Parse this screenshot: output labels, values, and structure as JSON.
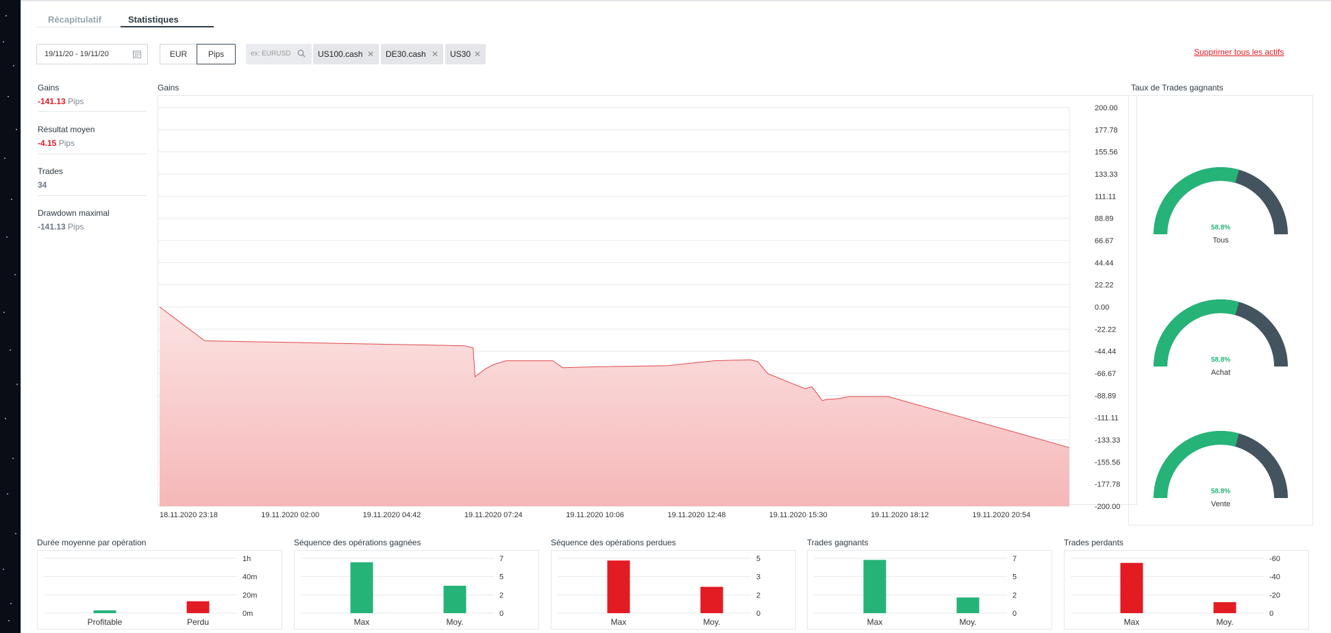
{
  "tabs": [
    {
      "label": "Récapitulatif",
      "active": false
    },
    {
      "label": "Statistiques",
      "active": true
    }
  ],
  "filters": {
    "date_range": "19/11/20 - 19/11/20",
    "units": [
      {
        "label": "EUR",
        "active": false
      },
      {
        "label": "Pips",
        "active": true
      }
    ],
    "search_placeholder": "ex: EURUSD",
    "assets": [
      "US100.cash",
      "DE30.cash",
      "US30"
    ],
    "remove_all": "Supprimer tous les actifs"
  },
  "stats": [
    {
      "label": "Gains",
      "value": "-141.13",
      "unit": "Pips",
      "tone": "red"
    },
    {
      "label": "Résultat moyen",
      "value": "-4.15",
      "unit": "Pips",
      "tone": "red"
    },
    {
      "label": "Trades",
      "value": "34",
      "unit": "",
      "tone": "grey"
    },
    {
      "label": "Drawdown maximal",
      "value": "-141.13",
      "unit": "Pips",
      "tone": "grey"
    }
  ],
  "main_chart_title": "Gains",
  "winrate_title": "Taux de Trades gagnants",
  "chart_data": [
    {
      "type": "area",
      "title": "Gains",
      "ylim": [
        -200,
        200
      ],
      "y_ticks": [
        "200.00",
        "177.78",
        "155.56",
        "133.33",
        "111.11",
        "88.89",
        "66.67",
        "44.44",
        "22.22",
        "0.00",
        "-22.22",
        "-44.44",
        "-66.67",
        "-88.89",
        "-111.11",
        "-133.33",
        "-155.56",
        "-177.78",
        "-200.00"
      ],
      "x_ticks": [
        "18.11.2020 23:18",
        "19.11.2020 02:00",
        "19.11.2020 04:42",
        "19.11.2020 07:24",
        "19.11.2020 10:06",
        "19.11.2020 12:48",
        "19.11.2020 15:30",
        "19.11.2020 18:12",
        "19.11.2020 20:54"
      ],
      "series": [
        {
          "x": [
            "18.11.2020 23:18",
            "19.11.2020 00:30",
            "19.11.2020 07:24",
            "19.11.2020 07:38",
            "19.11.2020 07:41",
            "19.11.2020 07:58",
            "19.11.2020 08:10",
            "19.11.2020 08:30",
            "19.11.2020 09:45",
            "19.11.2020 10:01",
            "19.11.2020 11:00",
            "19.11.2020 12:48",
            "19.11.2020 14:02",
            "19.11.2020 15:00",
            "19.11.2020 15:12",
            "19.11.2020 15:28",
            "19.11.2020 16:27",
            "19.11.2020 16:38",
            "19.11.2020 16:55",
            "19.11.2020 17:00",
            "19.11.2020 17:20",
            "19.11.2020 17:37",
            "19.11.2020 18:40",
            "19.11.2020 23:45"
          ],
          "y": [
            0,
            -34,
            -39,
            -41,
            -70,
            -62,
            -58,
            -54,
            -54,
            -61,
            -60,
            -59,
            -54,
            -53,
            -55,
            -67,
            -82,
            -80,
            -94,
            -93,
            -92,
            -90,
            -90,
            -141.13
          ]
        }
      ]
    },
    {
      "type": "gauge",
      "title": "Taux de Trades gagnants",
      "items": [
        {
          "label": "Tous",
          "value": 58.8,
          "display": "58.8%"
        },
        {
          "label": "Achat",
          "value": 58.8,
          "display": "58.8%"
        },
        {
          "label": "Vente",
          "value": 58.8,
          "display": "58.8%"
        }
      ]
    },
    {
      "type": "bar",
      "title": "Durée moyenne par opération",
      "categories": [
        "Profitable",
        "Perdu"
      ],
      "values_min": [
        3,
        13
      ],
      "ylim_min": [
        0,
        60
      ],
      "y_ticks": [
        "1h",
        "40m",
        "20m",
        "0m"
      ]
    },
    {
      "type": "bar",
      "title": "Séquence des opérations gagnées",
      "categories": [
        "Max",
        "Moy."
      ],
      "values": [
        6.5,
        3.5
      ],
      "ylim": [
        0,
        7
      ],
      "y_ticks": [
        "7",
        "5",
        "2",
        "0"
      ]
    },
    {
      "type": "bar",
      "title": "Séquence des opérations perdues",
      "categories": [
        "Max",
        "Moy."
      ],
      "values": [
        4.8,
        2.4
      ],
      "ylim": [
        0,
        5
      ],
      "y_ticks": [
        "5",
        "3",
        "2",
        "0"
      ]
    },
    {
      "type": "bar",
      "title": "Trades gagnants",
      "categories": [
        "Max",
        "Moy."
      ],
      "values": [
        6.8,
        2.0
      ],
      "ylim": [
        0,
        7
      ],
      "y_ticks": [
        "7",
        "5",
        "2",
        "0"
      ]
    },
    {
      "type": "bar",
      "title": "Trades perdants",
      "categories": [
        "Max",
        "Moy."
      ],
      "values": [
        -55,
        -12
      ],
      "ylim": [
        0,
        -60
      ],
      "y_ticks": [
        "-60",
        "-40",
        "-20",
        "0"
      ]
    }
  ],
  "colors": {
    "green": "#26b378",
    "red": "#e31b23",
    "slate": "#43545f",
    "area_line": "#e0474c"
  }
}
